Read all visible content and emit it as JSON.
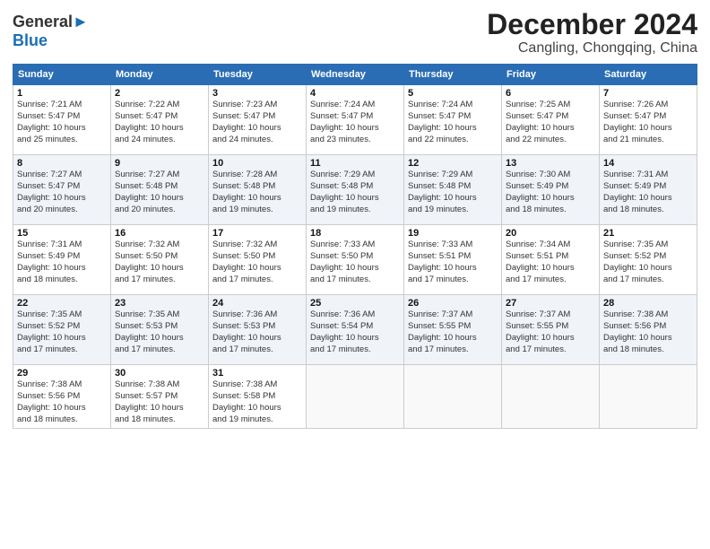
{
  "header": {
    "logo_line1": "General",
    "logo_line2": "Blue",
    "month": "December 2024",
    "location": "Cangling, Chongqing, China"
  },
  "days_of_week": [
    "Sunday",
    "Monday",
    "Tuesday",
    "Wednesday",
    "Thursday",
    "Friday",
    "Saturday"
  ],
  "weeks": [
    [
      {
        "day": "1",
        "info": "Sunrise: 7:21 AM\nSunset: 5:47 PM\nDaylight: 10 hours\nand 25 minutes."
      },
      {
        "day": "2",
        "info": "Sunrise: 7:22 AM\nSunset: 5:47 PM\nDaylight: 10 hours\nand 24 minutes."
      },
      {
        "day": "3",
        "info": "Sunrise: 7:23 AM\nSunset: 5:47 PM\nDaylight: 10 hours\nand 24 minutes."
      },
      {
        "day": "4",
        "info": "Sunrise: 7:24 AM\nSunset: 5:47 PM\nDaylight: 10 hours\nand 23 minutes."
      },
      {
        "day": "5",
        "info": "Sunrise: 7:24 AM\nSunset: 5:47 PM\nDaylight: 10 hours\nand 22 minutes."
      },
      {
        "day": "6",
        "info": "Sunrise: 7:25 AM\nSunset: 5:47 PM\nDaylight: 10 hours\nand 22 minutes."
      },
      {
        "day": "7",
        "info": "Sunrise: 7:26 AM\nSunset: 5:47 PM\nDaylight: 10 hours\nand 21 minutes."
      }
    ],
    [
      {
        "day": "8",
        "info": "Sunrise: 7:27 AM\nSunset: 5:47 PM\nDaylight: 10 hours\nand 20 minutes."
      },
      {
        "day": "9",
        "info": "Sunrise: 7:27 AM\nSunset: 5:48 PM\nDaylight: 10 hours\nand 20 minutes."
      },
      {
        "day": "10",
        "info": "Sunrise: 7:28 AM\nSunset: 5:48 PM\nDaylight: 10 hours\nand 19 minutes."
      },
      {
        "day": "11",
        "info": "Sunrise: 7:29 AM\nSunset: 5:48 PM\nDaylight: 10 hours\nand 19 minutes."
      },
      {
        "day": "12",
        "info": "Sunrise: 7:29 AM\nSunset: 5:48 PM\nDaylight: 10 hours\nand 19 minutes."
      },
      {
        "day": "13",
        "info": "Sunrise: 7:30 AM\nSunset: 5:49 PM\nDaylight: 10 hours\nand 18 minutes."
      },
      {
        "day": "14",
        "info": "Sunrise: 7:31 AM\nSunset: 5:49 PM\nDaylight: 10 hours\nand 18 minutes."
      }
    ],
    [
      {
        "day": "15",
        "info": "Sunrise: 7:31 AM\nSunset: 5:49 PM\nDaylight: 10 hours\nand 18 minutes."
      },
      {
        "day": "16",
        "info": "Sunrise: 7:32 AM\nSunset: 5:50 PM\nDaylight: 10 hours\nand 17 minutes."
      },
      {
        "day": "17",
        "info": "Sunrise: 7:32 AM\nSunset: 5:50 PM\nDaylight: 10 hours\nand 17 minutes."
      },
      {
        "day": "18",
        "info": "Sunrise: 7:33 AM\nSunset: 5:50 PM\nDaylight: 10 hours\nand 17 minutes."
      },
      {
        "day": "19",
        "info": "Sunrise: 7:33 AM\nSunset: 5:51 PM\nDaylight: 10 hours\nand 17 minutes."
      },
      {
        "day": "20",
        "info": "Sunrise: 7:34 AM\nSunset: 5:51 PM\nDaylight: 10 hours\nand 17 minutes."
      },
      {
        "day": "21",
        "info": "Sunrise: 7:35 AM\nSunset: 5:52 PM\nDaylight: 10 hours\nand 17 minutes."
      }
    ],
    [
      {
        "day": "22",
        "info": "Sunrise: 7:35 AM\nSunset: 5:52 PM\nDaylight: 10 hours\nand 17 minutes."
      },
      {
        "day": "23",
        "info": "Sunrise: 7:35 AM\nSunset: 5:53 PM\nDaylight: 10 hours\nand 17 minutes."
      },
      {
        "day": "24",
        "info": "Sunrise: 7:36 AM\nSunset: 5:53 PM\nDaylight: 10 hours\nand 17 minutes."
      },
      {
        "day": "25",
        "info": "Sunrise: 7:36 AM\nSunset: 5:54 PM\nDaylight: 10 hours\nand 17 minutes."
      },
      {
        "day": "26",
        "info": "Sunrise: 7:37 AM\nSunset: 5:55 PM\nDaylight: 10 hours\nand 17 minutes."
      },
      {
        "day": "27",
        "info": "Sunrise: 7:37 AM\nSunset: 5:55 PM\nDaylight: 10 hours\nand 17 minutes."
      },
      {
        "day": "28",
        "info": "Sunrise: 7:38 AM\nSunset: 5:56 PM\nDaylight: 10 hours\nand 18 minutes."
      }
    ],
    [
      {
        "day": "29",
        "info": "Sunrise: 7:38 AM\nSunset: 5:56 PM\nDaylight: 10 hours\nand 18 minutes."
      },
      {
        "day": "30",
        "info": "Sunrise: 7:38 AM\nSunset: 5:57 PM\nDaylight: 10 hours\nand 18 minutes."
      },
      {
        "day": "31",
        "info": "Sunrise: 7:38 AM\nSunset: 5:58 PM\nDaylight: 10 hours\nand 19 minutes."
      },
      {
        "day": "",
        "info": ""
      },
      {
        "day": "",
        "info": ""
      },
      {
        "day": "",
        "info": ""
      },
      {
        "day": "",
        "info": ""
      }
    ]
  ]
}
